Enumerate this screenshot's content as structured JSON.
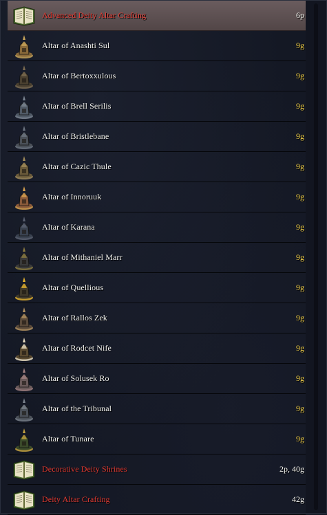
{
  "items": [
    {
      "label": "Advanced Deity Altar Crafting",
      "price": "6p",
      "kind": "book",
      "selected": true,
      "red": true,
      "price_style": "white",
      "icon": "book-icon"
    },
    {
      "label": "Altar of Anashti Sul",
      "price": "9g",
      "kind": "altar",
      "icon": "altar-icon",
      "colors": [
        "#8a6a3a",
        "#c6a35a"
      ]
    },
    {
      "label": "Altar of Bertoxxulous",
      "price": "9g",
      "kind": "altar",
      "icon": "altar-icon",
      "colors": [
        "#4a4030",
        "#7a6a50"
      ]
    },
    {
      "label": "Altar of Brell Serilis",
      "price": "9g",
      "kind": "altar",
      "icon": "altar-icon",
      "colors": [
        "#505a66",
        "#7a8490"
      ]
    },
    {
      "label": "Altar of Bristlebane",
      "price": "9g",
      "kind": "altar",
      "icon": "altar-icon",
      "colors": [
        "#4a5058",
        "#6c7480"
      ]
    },
    {
      "label": "Altar of Cazic Thule",
      "price": "9g",
      "kind": "altar",
      "icon": "altar-icon",
      "colors": [
        "#6a5a3a",
        "#a08a5a"
      ]
    },
    {
      "label": "Altar of Innoruuk",
      "price": "9g",
      "kind": "altar",
      "icon": "altar-icon",
      "colors": [
        "#8a5a3a",
        "#d6a050"
      ]
    },
    {
      "label": "Altar of Karana",
      "price": "9g",
      "kind": "altar",
      "icon": "altar-icon",
      "colors": [
        "#3a4250",
        "#5a6070"
      ]
    },
    {
      "label": "Altar of Mithaniel Marr",
      "price": "9g",
      "kind": "altar",
      "icon": "altar-icon",
      "colors": [
        "#3a3a3a",
        "#8a7a40"
      ]
    },
    {
      "label": "Altar of Quellious",
      "price": "9g",
      "kind": "altar",
      "icon": "altar-icon",
      "colors": [
        "#403a2a",
        "#e0b030"
      ]
    },
    {
      "label": "Altar of Rallos Zek",
      "price": "9g",
      "kind": "altar",
      "icon": "altar-icon",
      "colors": [
        "#5a4a3a",
        "#b09060"
      ]
    },
    {
      "label": "Altar of Rodcet Nife",
      "price": "9g",
      "kind": "altar",
      "icon": "altar-icon",
      "colors": [
        "#5a4a30",
        "#e8dcc0"
      ]
    },
    {
      "label": "Altar of Solusek Ro",
      "price": "9g",
      "kind": "altar",
      "icon": "altar-icon",
      "colors": [
        "#6a5a5a",
        "#a08080"
      ]
    },
    {
      "label": "Altar of the Tribunal",
      "price": "9g",
      "kind": "altar",
      "icon": "altar-icon",
      "colors": [
        "#4a5058",
        "#78808a"
      ]
    },
    {
      "label": "Altar of Tunare",
      "price": "9g",
      "kind": "altar",
      "icon": "altar-icon",
      "colors": [
        "#3a4a2a",
        "#c0a040"
      ]
    },
    {
      "label": "Decorative Deity Shrines",
      "price": "2p, 40g",
      "kind": "book",
      "red": true,
      "price_style": "white",
      "icon": "book-icon"
    },
    {
      "label": "Deity Altar Crafting",
      "price": "42g",
      "kind": "book",
      "red": true,
      "price_style": "white",
      "icon": "book-icon"
    }
  ]
}
